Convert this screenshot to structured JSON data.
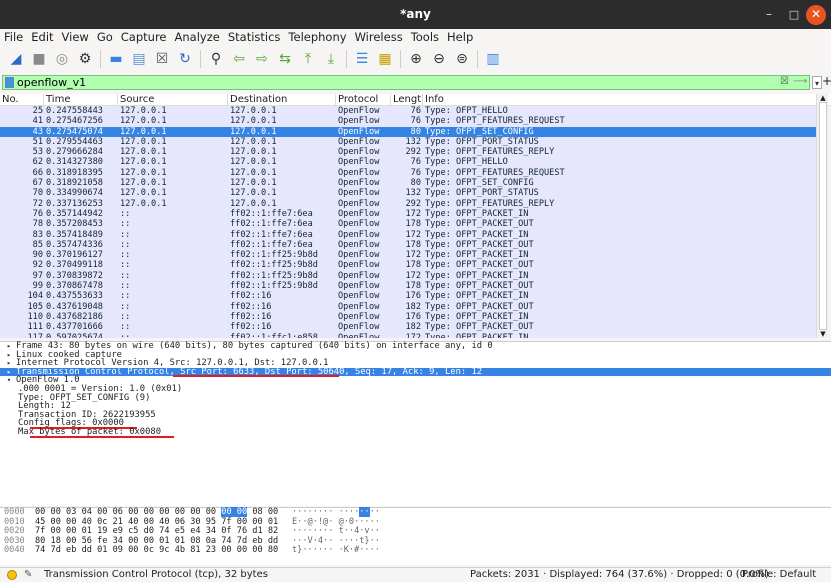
{
  "window": {
    "title": "*any"
  },
  "menu": [
    "File",
    "Edit",
    "View",
    "Go",
    "Capture",
    "Analyze",
    "Statistics",
    "Telephony",
    "Wireless",
    "Tools",
    "Help"
  ],
  "toolbar": [
    {
      "name": "start-capture-icon",
      "glyph": "◢",
      "color": "#2a6ac8"
    },
    {
      "name": "stop-capture-icon",
      "glyph": "■",
      "color": "#8a8a8a"
    },
    {
      "name": "restart-capture-icon",
      "glyph": "◎",
      "color": "#8a8a8a"
    },
    {
      "name": "capture-options-icon",
      "glyph": "⚙",
      "color": "#333333"
    },
    {
      "name": "open-file-icon",
      "glyph": "▬",
      "color": "#3584e4"
    },
    {
      "name": "save-file-icon",
      "glyph": "▤",
      "color": "#5c8fd6"
    },
    {
      "name": "close-file-icon",
      "glyph": "☒",
      "color": "#555555"
    },
    {
      "name": "reload-file-icon",
      "glyph": "↻",
      "color": "#2a6ac8"
    },
    {
      "name": "find-packet-icon",
      "glyph": "⚲",
      "color": "#333333"
    },
    {
      "name": "go-back-icon",
      "glyph": "⇦",
      "color": "#57a639"
    },
    {
      "name": "go-forward-icon",
      "glyph": "⇨",
      "color": "#57a639"
    },
    {
      "name": "go-to-packet-icon",
      "glyph": "⇆",
      "color": "#57a639"
    },
    {
      "name": "first-packet-icon",
      "glyph": "⤒",
      "color": "#57a639"
    },
    {
      "name": "last-packet-icon",
      "glyph": "⤓",
      "color": "#57a639"
    },
    {
      "name": "autoscroll-icon",
      "glyph": "☰",
      "color": "#3584e4"
    },
    {
      "name": "colorize-icon",
      "glyph": "▦",
      "color": "#c69c00"
    },
    {
      "name": "zoom-in-icon",
      "glyph": "⊕",
      "color": "#333333"
    },
    {
      "name": "zoom-out-icon",
      "glyph": "⊖",
      "color": "#333333"
    },
    {
      "name": "zoom-reset-icon",
      "glyph": "⊜",
      "color": "#333333"
    },
    {
      "name": "resize-columns-icon",
      "glyph": "▥",
      "color": "#3584e4"
    }
  ],
  "filter": {
    "value": "openflow_v1"
  },
  "columns": [
    "No.",
    "Time",
    "Source",
    "Destination",
    "Protocol",
    "Length",
    "Info"
  ],
  "packets": [
    [
      "25",
      "0.247558443",
      "127.0.0.1",
      "127.0.0.1",
      "OpenFlow",
      "76",
      "Type: OFPT_HELLO"
    ],
    [
      "41",
      "0.275467256",
      "127.0.0.1",
      "127.0.0.1",
      "OpenFlow",
      "76",
      "Type: OFPT_FEATURES_REQUEST"
    ],
    [
      "43",
      "0.275475074",
      "127.0.0.1",
      "127.0.0.1",
      "OpenFlow",
      "80",
      "Type: OFPT_SET_CONFIG"
    ],
    [
      "51",
      "0.279554463",
      "127.0.0.1",
      "127.0.0.1",
      "OpenFlow",
      "132",
      "Type: OFPT_PORT_STATUS"
    ],
    [
      "53",
      "0.279666284",
      "127.0.0.1",
      "127.0.0.1",
      "OpenFlow",
      "292",
      "Type: OFPT_FEATURES_REPLY"
    ],
    [
      "62",
      "0.314327380",
      "127.0.0.1",
      "127.0.0.1",
      "OpenFlow",
      "76",
      "Type: OFPT_HELLO"
    ],
    [
      "66",
      "0.318918395",
      "127.0.0.1",
      "127.0.0.1",
      "OpenFlow",
      "76",
      "Type: OFPT_FEATURES_REQUEST"
    ],
    [
      "67",
      "0.318921058",
      "127.0.0.1",
      "127.0.0.1",
      "OpenFlow",
      "80",
      "Type: OFPT_SET_CONFIG"
    ],
    [
      "70",
      "0.334990674",
      "127.0.0.1",
      "127.0.0.1",
      "OpenFlow",
      "132",
      "Type: OFPT_PORT_STATUS"
    ],
    [
      "72",
      "0.337136253",
      "127.0.0.1",
      "127.0.0.1",
      "OpenFlow",
      "292",
      "Type: OFPT_FEATURES_REPLY"
    ],
    [
      "76",
      "0.357144942",
      "::",
      "ff02::1:ffe7:6ea",
      "OpenFlow",
      "172",
      "Type: OFPT_PACKET_IN"
    ],
    [
      "78",
      "0.357208453",
      "::",
      "ff02::1:ffe7:6ea",
      "OpenFlow",
      "178",
      "Type: OFPT_PACKET_OUT"
    ],
    [
      "83",
      "0.357418489",
      "::",
      "ff02::1:ffe7:6ea",
      "OpenFlow",
      "172",
      "Type: OFPT_PACKET_IN"
    ],
    [
      "85",
      "0.357474336",
      "::",
      "ff02::1:ffe7:6ea",
      "OpenFlow",
      "178",
      "Type: OFPT_PACKET_OUT"
    ],
    [
      "90",
      "0.370196127",
      "::",
      "ff02::1:ff25:9b8d",
      "OpenFlow",
      "172",
      "Type: OFPT_PACKET_IN"
    ],
    [
      "92",
      "0.370499118",
      "::",
      "ff02::1:ff25:9b8d",
      "OpenFlow",
      "178",
      "Type: OFPT_PACKET_OUT"
    ],
    [
      "97",
      "0.370839872",
      "::",
      "ff02::1:ff25:9b8d",
      "OpenFlow",
      "172",
      "Type: OFPT_PACKET_IN"
    ],
    [
      "99",
      "0.370867478",
      "::",
      "ff02::1:ff25:9b8d",
      "OpenFlow",
      "178",
      "Type: OFPT_PACKET_OUT"
    ],
    [
      "104",
      "0.437553633",
      "::",
      "ff02::16",
      "OpenFlow",
      "176",
      "Type: OFPT_PACKET_IN"
    ],
    [
      "105",
      "0.437619048",
      "::",
      "ff02::16",
      "OpenFlow",
      "182",
      "Type: OFPT_PACKET_OUT"
    ],
    [
      "110",
      "0.437682186",
      "::",
      "ff02::16",
      "OpenFlow",
      "176",
      "Type: OFPT_PACKET_IN"
    ],
    [
      "111",
      "0.437701666",
      "::",
      "ff02::16",
      "OpenFlow",
      "182",
      "Type: OFPT_PACKET_OUT"
    ],
    [
      "117",
      "0.597025674",
      "::",
      "ff02::1:ffc1:e858",
      "OpenFlow",
      "172",
      "Type: OFPT_PACKET_IN"
    ]
  ],
  "selected_packet_index": 2,
  "details": [
    {
      "indent": 0,
      "toggle": "▸",
      "text": "Frame 43: 80 bytes on wire (640 bits), 80 bytes captured (640 bits) on interface any, id 0"
    },
    {
      "indent": 0,
      "toggle": "▸",
      "text": "Linux cooked capture"
    },
    {
      "indent": 0,
      "toggle": "▸",
      "text": "Internet Protocol Version 4, Src: 127.0.0.1, Dst: 127.0.0.1"
    },
    {
      "indent": 0,
      "toggle": "▸",
      "text": "Transmission Control Protocol, Src Port: 6633, Dst Port: 50640, Seq: 17, Ack: 9, Len: 12",
      "selected": true
    },
    {
      "indent": 0,
      "toggle": "▾",
      "text": "OpenFlow 1.0"
    },
    {
      "indent": 1,
      "toggle": "",
      "text": ".000 0001 = Version: 1.0 (0x01)"
    },
    {
      "indent": 1,
      "toggle": "",
      "text": "Type: OFPT_SET_CONFIG (9)"
    },
    {
      "indent": 1,
      "toggle": "",
      "text": "Length: 12"
    },
    {
      "indent": 1,
      "toggle": "",
      "text": "Transaction ID: 2622193955"
    },
    {
      "indent": 1,
      "toggle": "",
      "text": "Config flags: 0x0000",
      "underline": true
    },
    {
      "indent": 1,
      "toggle": "",
      "text": "Max bytes of packet: 0x0080",
      "underline": true
    }
  ],
  "bytes": [
    {
      "offset": "0000",
      "hex_pre": "00 00 03 04 00 06 00 00  00 00 00 00 ",
      "hex_hl": "00 00",
      "hex_post": " 08 00",
      "ascii_pre": "········ ····",
      "ascii_hl": "··",
      "ascii_post": "··"
    },
    {
      "offset": "0010",
      "hex_pre": "45 00 00 40 0c 21 40 00  40 06 30 95 7f 00 00 01",
      "hex_hl": "",
      "hex_post": "",
      "ascii_pre": "E··@·!@· @·0·····",
      "ascii_hl": "",
      "ascii_post": ""
    },
    {
      "offset": "0020",
      "hex_pre": "7f 00 00 01 19 e9 c5 d0  74 e5 e4 34 0f 76 d1 82",
      "hex_hl": "",
      "hex_post": "",
      "ascii_pre": "········ t··4·v··",
      "ascii_hl": "",
      "ascii_post": ""
    },
    {
      "offset": "0030",
      "hex_pre": "80 18 00 56 fe 34 00 00  01 01 08 0a 74 7d eb dd",
      "hex_hl": "",
      "hex_post": "",
      "ascii_pre": "···V·4·· ····t}··",
      "ascii_hl": "",
      "ascii_post": ""
    },
    {
      "offset": "0040",
      "hex_pre": "74 7d eb dd 01 09 00 0c  9c 4b 81 23 00 00 00 80",
      "hex_hl": "",
      "hex_post": "",
      "ascii_pre": "t}······ ·K·#····",
      "ascii_hl": "",
      "ascii_post": ""
    }
  ],
  "status": {
    "text": "Transmission Control Protocol (tcp), 32 bytes",
    "stats": "Packets: 2031 · Displayed: 764 (37.6%) · Dropped: 0 (0.0%)",
    "profile": "Profile: Default"
  },
  "colors": {
    "selected": "#3584e4",
    "row": "#e7e6ff",
    "filter_ok": "#afffaf",
    "annotation": "#e01b24"
  }
}
